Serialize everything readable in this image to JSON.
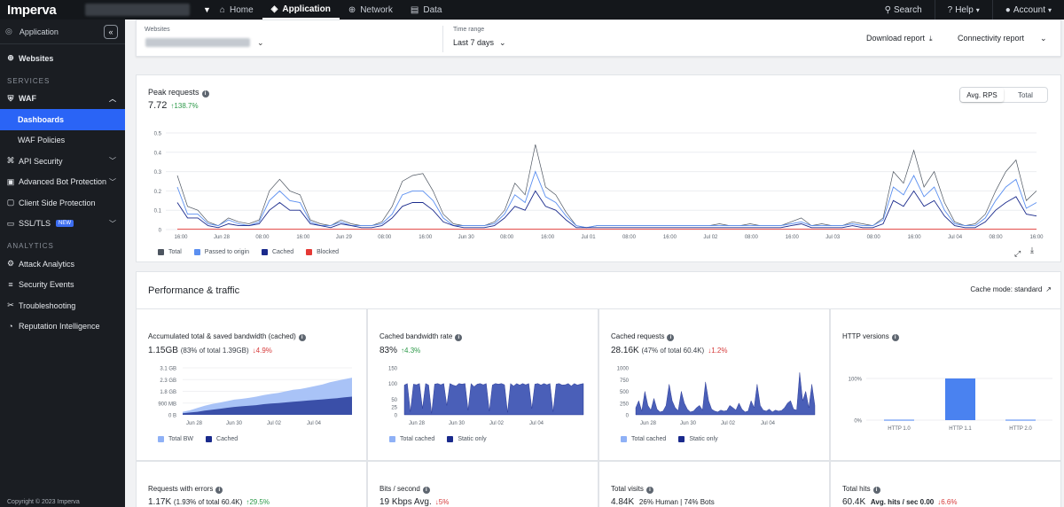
{
  "topbar": {
    "logo": "Imperva",
    "tabs": [
      {
        "label": "Home",
        "icon": "home-icon"
      },
      {
        "label": "Application",
        "icon": "layers-icon"
      },
      {
        "label": "Network",
        "icon": "globe-icon"
      },
      {
        "label": "Data",
        "icon": "database-icon"
      }
    ],
    "search_label": "Search",
    "help_label": "Help",
    "account_label": "Account"
  },
  "sidebar": {
    "app_label": "Application",
    "websites_label": "Websites",
    "services_header": "SERVICES",
    "waf_label": "WAF",
    "dashboards_label": "Dashboards",
    "waf_policies_label": "WAF Policies",
    "api_security_label": "API Security",
    "bot_protection_label": "Advanced Bot Protection",
    "client_side_label": "Client Side Protection",
    "ssl_label": "SSL/TLS",
    "new_badge": "NEW",
    "analytics_header": "ANALYTICS",
    "attack_analytics_label": "Attack Analytics",
    "security_events_label": "Security Events",
    "troubleshooting_label": "Troubleshooting",
    "reputation_label": "Reputation Intelligence",
    "copyright": "Copyright © 2023 Imperva"
  },
  "filterbar": {
    "websites_label": "Websites",
    "time_range_label": "Time range",
    "time_range_value": "Last 7 days",
    "download_label": "Download report",
    "connectivity_label": "Connectivity report"
  },
  "peak": {
    "title": "Peak requests",
    "value": "7.72",
    "change": "↑138.7%",
    "toggle_avg": "Avg. RPS",
    "toggle_total": "Total",
    "legend": [
      {
        "label": "Total",
        "color": "#4d5560"
      },
      {
        "label": "Passed to origin",
        "color": "#5b8ff0"
      },
      {
        "label": "Cached",
        "color": "#1a2a8c"
      },
      {
        "label": "Blocked",
        "color": "#e53935"
      }
    ]
  },
  "chart_data": [
    {
      "type": "line",
      "title": "Peak requests",
      "ylim": [
        0,
        0.5
      ],
      "yticks": [
        "0",
        "0.1",
        "0.2",
        "0.3",
        "0.4",
        "0.5"
      ],
      "xticks": [
        "16:00",
        "Jun 28",
        "08:00",
        "16:00",
        "Jun 29",
        "08:00",
        "16:00",
        "Jun 30",
        "08:00",
        "16:00",
        "Jul 01",
        "08:00",
        "16:00",
        "Jul 02",
        "08:00",
        "16:00",
        "Jul 03",
        "08:00",
        "16:00",
        "Jul 04",
        "08:00",
        "16:00"
      ],
      "series": [
        {
          "name": "Total",
          "values": [
            0.28,
            0.12,
            0.1,
            0.04,
            0.02,
            0.06,
            0.04,
            0.03,
            0.05,
            0.2,
            0.26,
            0.2,
            0.18,
            0.05,
            0.03,
            0.02,
            0.05,
            0.03,
            0.02,
            0.02,
            0.04,
            0.12,
            0.25,
            0.28,
            0.29,
            0.2,
            0.08,
            0.03,
            0.02,
            0.02,
            0.02,
            0.04,
            0.1,
            0.24,
            0.18,
            0.44,
            0.22,
            0.18,
            0.09,
            0.02,
            0.01,
            0.02,
            0.02,
            0.02,
            0.02,
            0.02,
            0.02,
            0.02,
            0.02,
            0.02,
            0.02,
            0.02,
            0.02,
            0.03,
            0.02,
            0.02,
            0.03,
            0.02,
            0.02,
            0.02,
            0.04,
            0.06,
            0.02,
            0.03,
            0.02,
            0.02,
            0.04,
            0.03,
            0.02,
            0.06,
            0.3,
            0.24,
            0.41,
            0.22,
            0.3,
            0.14,
            0.04,
            0.02,
            0.03,
            0.08,
            0.2,
            0.3,
            0.36,
            0.15,
            0.2
          ]
        },
        {
          "name": "Passed to origin",
          "values": [
            0.22,
            0.08,
            0.08,
            0.03,
            0.02,
            0.05,
            0.03,
            0.02,
            0.04,
            0.15,
            0.2,
            0.15,
            0.14,
            0.04,
            0.02,
            0.02,
            0.04,
            0.02,
            0.02,
            0.02,
            0.03,
            0.08,
            0.18,
            0.2,
            0.2,
            0.15,
            0.06,
            0.02,
            0.02,
            0.02,
            0.02,
            0.03,
            0.08,
            0.18,
            0.14,
            0.3,
            0.17,
            0.14,
            0.07,
            0.02,
            0.01,
            0.02,
            0.02,
            0.02,
            0.02,
            0.02,
            0.02,
            0.02,
            0.02,
            0.02,
            0.02,
            0.02,
            0.02,
            0.02,
            0.02,
            0.02,
            0.02,
            0.02,
            0.02,
            0.02,
            0.03,
            0.04,
            0.02,
            0.02,
            0.02,
            0.02,
            0.03,
            0.02,
            0.02,
            0.05,
            0.22,
            0.18,
            0.28,
            0.17,
            0.22,
            0.1,
            0.03,
            0.02,
            0.02,
            0.06,
            0.15,
            0.22,
            0.26,
            0.11,
            0.14
          ]
        },
        {
          "name": "Cached",
          "values": [
            0.14,
            0.06,
            0.06,
            0.02,
            0.01,
            0.03,
            0.02,
            0.02,
            0.03,
            0.1,
            0.14,
            0.1,
            0.1,
            0.03,
            0.02,
            0.01,
            0.03,
            0.02,
            0.01,
            0.01,
            0.02,
            0.06,
            0.12,
            0.14,
            0.14,
            0.1,
            0.04,
            0.02,
            0.01,
            0.01,
            0.01,
            0.02,
            0.06,
            0.12,
            0.1,
            0.2,
            0.12,
            0.1,
            0.05,
            0.01,
            0.01,
            0.01,
            0.01,
            0.01,
            0.01,
            0.01,
            0.01,
            0.01,
            0.01,
            0.01,
            0.01,
            0.01,
            0.01,
            0.01,
            0.01,
            0.01,
            0.01,
            0.01,
            0.01,
            0.01,
            0.02,
            0.03,
            0.01,
            0.01,
            0.01,
            0.01,
            0.02,
            0.01,
            0.01,
            0.03,
            0.15,
            0.12,
            0.2,
            0.12,
            0.15,
            0.07,
            0.02,
            0.01,
            0.01,
            0.04,
            0.1,
            0.14,
            0.17,
            0.08,
            0.07
          ]
        },
        {
          "name": "Blocked",
          "values": [
            0.002,
            0.002,
            0.002,
            0.002,
            0.002,
            0.002,
            0.002,
            0.002,
            0.002,
            0.002,
            0.002,
            0.002,
            0.002,
            0.002,
            0.002,
            0.002,
            0.002,
            0.002,
            0.002,
            0.002,
            0.002,
            0.002,
            0.002,
            0.002,
            0.002,
            0.002,
            0.002,
            0.002,
            0.002,
            0.002,
            0.002,
            0.002,
            0.002,
            0.002,
            0.002,
            0.002,
            0.002,
            0.002,
            0.002,
            0.002,
            0.002,
            0.002,
            0.002,
            0.002,
            0.002,
            0.002,
            0.002,
            0.002,
            0.002,
            0.002,
            0.002,
            0.002,
            0.002,
            0.002,
            0.002,
            0.002,
            0.002,
            0.002,
            0.002,
            0.002,
            0.002,
            0.002,
            0.002,
            0.002,
            0.002,
            0.002,
            0.002,
            0.002,
            0.002,
            0.002,
            0.002,
            0.002,
            0.002,
            0.002,
            0.002,
            0.002,
            0.002,
            0.002,
            0.002,
            0.002,
            0.002,
            0.002,
            0.002,
            0.002,
            0.002
          ]
        }
      ]
    },
    {
      "type": "area",
      "title": "Accumulated total & saved bandwidth (cached)",
      "yticks": [
        "0 B",
        "900 MB",
        "1.8 GB",
        "2.3 GB",
        "3.1 GB"
      ],
      "xticks": [
        "Jun 28",
        "Jun 30",
        "Jul 02",
        "Jul 04"
      ],
      "series": [
        {
          "name": "Total BW",
          "values": [
            0.2,
            0.3,
            0.45,
            0.6,
            0.72,
            0.8,
            0.9,
            1.0,
            1.05,
            1.12,
            1.2,
            1.3,
            1.38,
            1.45,
            1.55,
            1.65,
            1.7,
            1.8,
            1.9,
            2.0,
            2.15,
            2.25,
            2.35,
            2.45
          ]
        },
        {
          "name": "Cached",
          "values": [
            0.1,
            0.15,
            0.2,
            0.28,
            0.34,
            0.4,
            0.46,
            0.52,
            0.56,
            0.6,
            0.64,
            0.7,
            0.74,
            0.78,
            0.82,
            0.86,
            0.9,
            0.94,
            0.98,
            1.02,
            1.06,
            1.1,
            1.15,
            1.2
          ]
        }
      ]
    },
    {
      "type": "area",
      "title": "Cached bandwidth rate",
      "yticks": [
        "0",
        "25",
        "50",
        "100",
        "150"
      ],
      "xticks": [
        "Jun 28",
        "Jun 30",
        "Jul 02",
        "Jul 04"
      ],
      "series": [
        {
          "name": "Total cached",
          "values": []
        },
        {
          "name": "Static only",
          "values": [
            95,
            100,
            10,
            98,
            96,
            100,
            20,
            100,
            95,
            5,
            98,
            100,
            96,
            100,
            30,
            100,
            95,
            92,
            100,
            98,
            100,
            15,
            100,
            90,
            98,
            100,
            96,
            100,
            12,
            95,
            100,
            98,
            100,
            96,
            8,
            100,
            92,
            100,
            95,
            100,
            96,
            100,
            20,
            98,
            100,
            95,
            100,
            96,
            100,
            10,
            98,
            100,
            95,
            96,
            100,
            92,
            100,
            95,
            98,
            100
          ]
        }
      ]
    },
    {
      "type": "area",
      "title": "Cached requests",
      "yticks": [
        "0",
        "250",
        "500",
        "750",
        "1000"
      ],
      "xticks": [
        "Jun 28",
        "Jun 30",
        "Jul 02",
        "Jul 04"
      ],
      "series": [
        {
          "name": "Total cached",
          "values": []
        },
        {
          "name": "Static only",
          "values": [
            150,
            300,
            80,
            500,
            200,
            100,
            350,
            120,
            60,
            80,
            200,
            650,
            300,
            150,
            90,
            500,
            250,
            120,
            60,
            80,
            150,
            200,
            100,
            700,
            300,
            120,
            80,
            60,
            100,
            80,
            90,
            200,
            150,
            100,
            250,
            120,
            60,
            80,
            300,
            150,
            650,
            200,
            100,
            80,
            120,
            60,
            100,
            80,
            90,
            150,
            250,
            300,
            120,
            100,
            900,
            300,
            500,
            150,
            650,
            200
          ]
        }
      ]
    },
    {
      "type": "bar",
      "title": "HTTP versions",
      "categories": [
        "HTTP 1.0",
        "HTTP 1.1",
        "HTTP 2.0"
      ],
      "values": [
        1,
        100,
        1
      ],
      "yticks": [
        "0%",
        "100%"
      ]
    }
  ],
  "perf": {
    "title": "Performance & traffic",
    "cache_mode": "Cache mode: standard",
    "bw": {
      "title": "Accumulated total & saved bandwidth (cached)",
      "value": "1.15GB",
      "sub": "(83% of total 1.39GB)",
      "change": "↓4.9%",
      "legend1": "Total BW",
      "legend2": "Cached"
    },
    "rate": {
      "title": "Cached bandwidth rate",
      "value": "83%",
      "change": "↑4.3%",
      "legend1": "Total cached",
      "legend2": "Static only"
    },
    "req": {
      "title": "Cached requests",
      "value": "28.16K",
      "sub": "(47% of total 60.4K)",
      "change": "↓1.2%",
      "legend1": "Total cached",
      "legend2": "Static only"
    },
    "http": {
      "title": "HTTP versions"
    },
    "errors": {
      "title": "Requests with errors",
      "value": "1.17K",
      "sub": "(1.93% of total 60.4K)",
      "change": "↑29.5%"
    },
    "bits": {
      "title": "Bits / second",
      "value": "19 Kbps Avg.",
      "change": "↓5%"
    },
    "visits": {
      "title": "Total visits",
      "value": "4.84K",
      "sub": "26% Human | 74% Bots"
    },
    "hits": {
      "title": "Total hits",
      "value": "60.4K",
      "sub": "Avg. hits / sec 0.00",
      "change": "↓6.6%"
    }
  },
  "colors": {
    "accent": "#2a64f6",
    "light_blue": "#8fb1f6",
    "dark_blue": "#1a2a8c",
    "mid_blue": "#5a72c4",
    "up": "#2e9a4a",
    "down": "#d63a3a"
  }
}
